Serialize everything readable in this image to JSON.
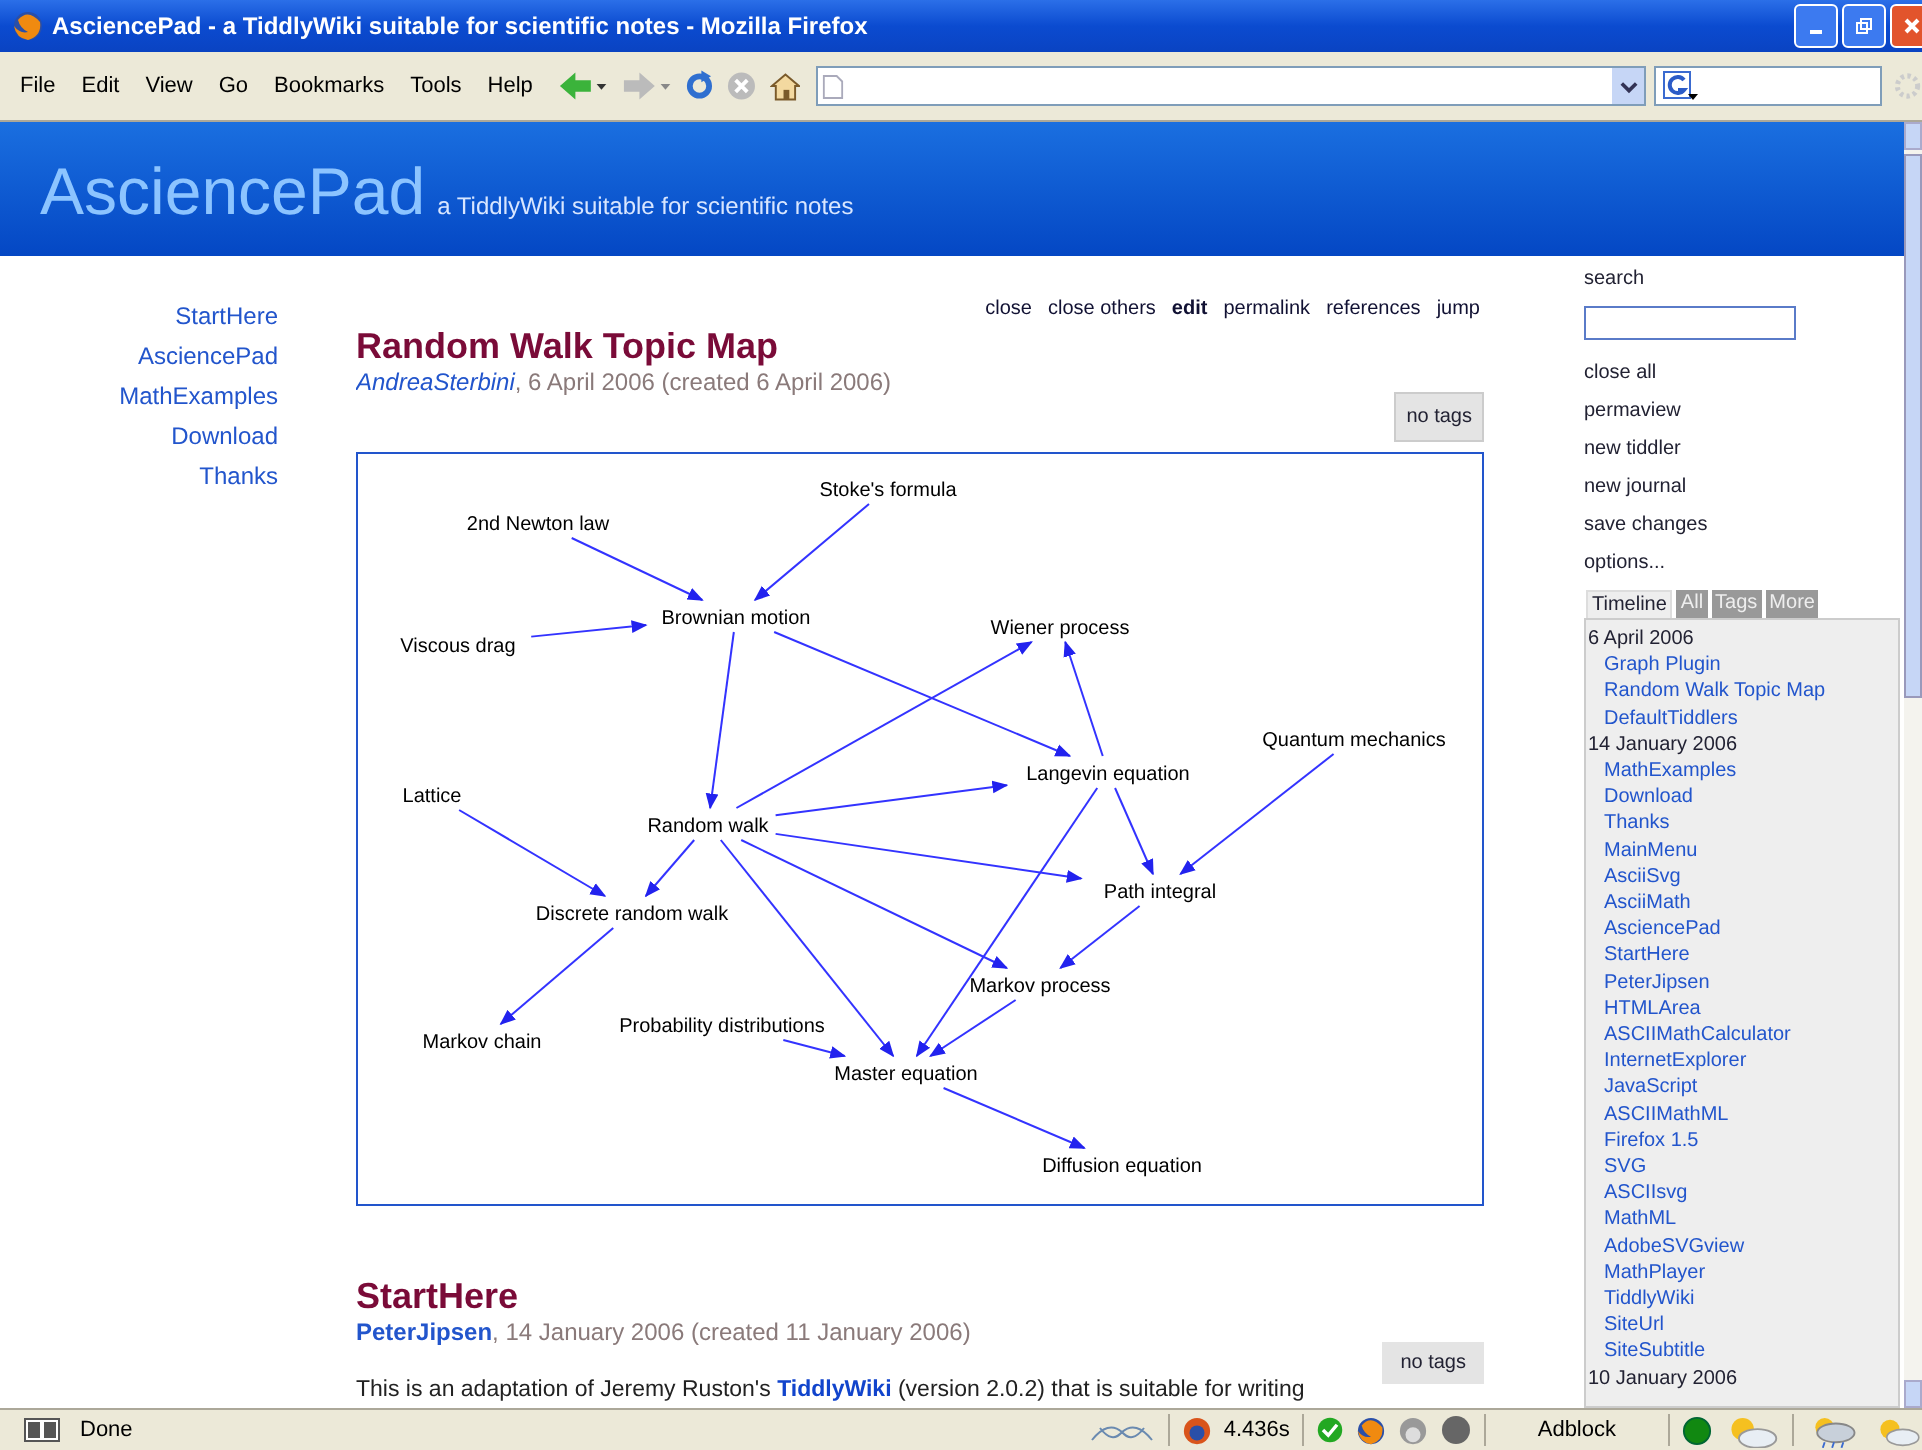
{
  "window": {
    "title": "AsciencePad - a TiddlyWiki suitable for scientific notes - Mozilla Firefox"
  },
  "menu": [
    "File",
    "Edit",
    "View",
    "Go",
    "Bookmarks",
    "Tools",
    "Help"
  ],
  "header": {
    "title": "AsciencePad",
    "subtitle": "a TiddlyWiki suitable for scientific notes"
  },
  "main_menu": [
    "StartHere",
    "AsciencePad",
    "MathExamples",
    "Download",
    "Thanks"
  ],
  "tiddlers": [
    {
      "kind": "graph",
      "toolbar": [
        {
          "label": "close",
          "emphasized": false
        },
        {
          "label": "close others",
          "emphasized": false
        },
        {
          "label": "edit",
          "emphasized": true
        },
        {
          "label": "permalink",
          "emphasized": false
        },
        {
          "label": "references",
          "emphasized": false
        },
        {
          "label": "jump",
          "emphasized": false
        }
      ],
      "title": "Random Walk Topic Map",
      "author": {
        "name": "AndreaSterbini",
        "italic": true,
        "bold": false
      },
      "date": ", 6 April 2006 (created 6 April 2006)",
      "tags": "no tags",
      "graph": {
        "nodes": [
          "Stoke's formula",
          "2nd Newton law",
          "Brownian motion",
          "Viscous drag",
          "Wiener process",
          "Langevin equation",
          "Quantum mechanics",
          "Lattice",
          "Random walk",
          "Path integral",
          "Discrete random walk",
          "Markov process",
          "Markov chain",
          "Probability distributions",
          "Master equation",
          "Diffusion equation"
        ]
      }
    },
    {
      "kind": "text",
      "title": "StartHere",
      "author": {
        "name": "PeterJipsen",
        "italic": false,
        "bold": true
      },
      "date": ", 14 January 2006 (created 11 January 2006)",
      "tags": "no tags",
      "body": {
        "before": "This is an adaptation of Jeremy Ruston's ",
        "link": "TiddlyWiki",
        "after": " (version 2.0.2) that is suitable for writing"
      }
    }
  ],
  "sidebar": {
    "search_label": "search",
    "commands": [
      "close all",
      "permaview",
      "new tiddler",
      "new journal",
      "save changes",
      "options..."
    ],
    "tabs": [
      {
        "label": "Timeline",
        "selected": true
      },
      {
        "label": "All",
        "selected": false
      },
      {
        "label": "Tags",
        "selected": false
      },
      {
        "label": "More",
        "selected": false
      }
    ],
    "timeline": [
      {
        "date": "6 April 2006",
        "items": [
          "Graph Plugin",
          "Random Walk Topic Map",
          "DefaultTiddlers"
        ]
      },
      {
        "date": "14 January 2006",
        "items": [
          "MathExamples",
          "Download",
          "Thanks",
          "MainMenu",
          "AsciiSvg",
          "AsciiMath",
          "AsciencePad",
          "StartHere",
          "PeterJipsen",
          "HTMLArea",
          "ASCIIMathCalculator",
          "InternetExplorer",
          "JavaScript",
          "ASCIIMathML",
          "Firefox 1.5",
          "SVG",
          "ASCIIsvg",
          "MathML",
          "AdobeSVGview",
          "MathPlayer",
          "TiddlyWiki",
          "SiteUrl",
          "SiteSubtitle"
        ]
      },
      {
        "date": "10 January 2006"
      }
    ]
  },
  "status_bar": {
    "text": "Done",
    "timing": "4.436s",
    "adblock": "Adblock"
  }
}
